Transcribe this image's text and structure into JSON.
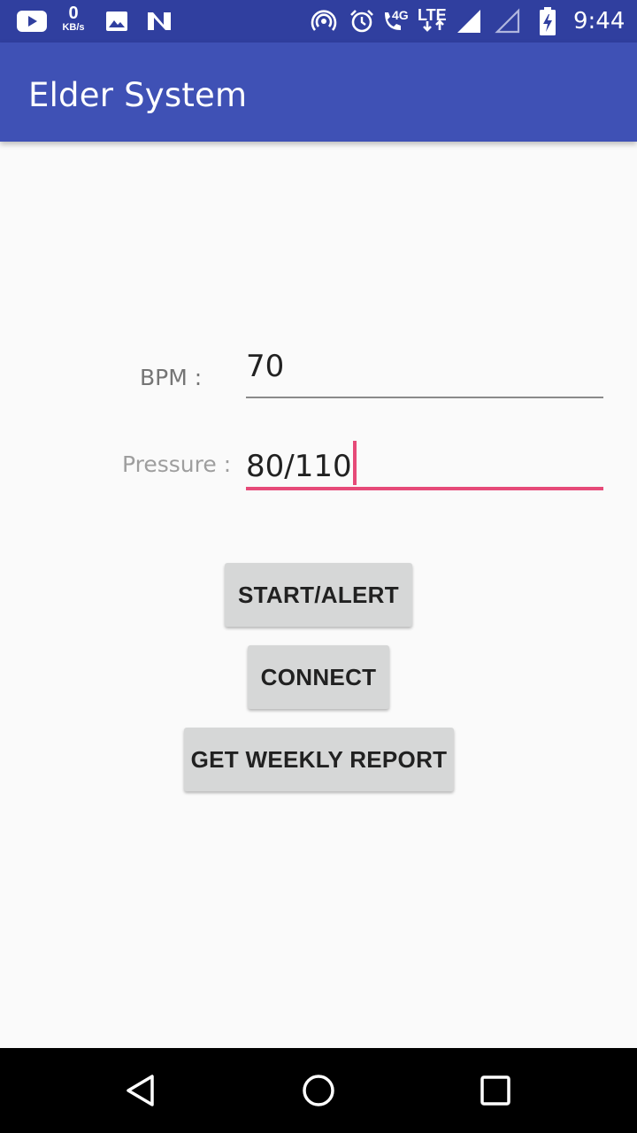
{
  "status_bar": {
    "kb_value": "0",
    "kb_unit": "KB/s",
    "network_4g": "4G",
    "network_lte": "LTE",
    "time": "9:44",
    "icons": [
      "youtube-icon",
      "image-icon",
      "n-app-icon",
      "hotspot-icon",
      "alarm-icon",
      "wifi-call-icon",
      "signal-icon",
      "signal-empty-icon",
      "battery-charging-icon"
    ]
  },
  "app_bar": {
    "title": "Elder System"
  },
  "form": {
    "bpm_label": "BPM :",
    "bpm_value": "70",
    "pressure_label": "Pressure :",
    "pressure_value": "80/110"
  },
  "buttons": {
    "start_alert": "START/ALERT",
    "connect": "CONNECT",
    "weekly_report": "GET WEEKLY REPORT"
  },
  "nav_bar": {
    "icons": [
      "back-icon",
      "home-icon",
      "recents-icon"
    ]
  },
  "colors": {
    "status_bar": "#303f9f",
    "app_bar": "#3f51b5",
    "accent": "#e64a78",
    "background": "#fafafa"
  }
}
